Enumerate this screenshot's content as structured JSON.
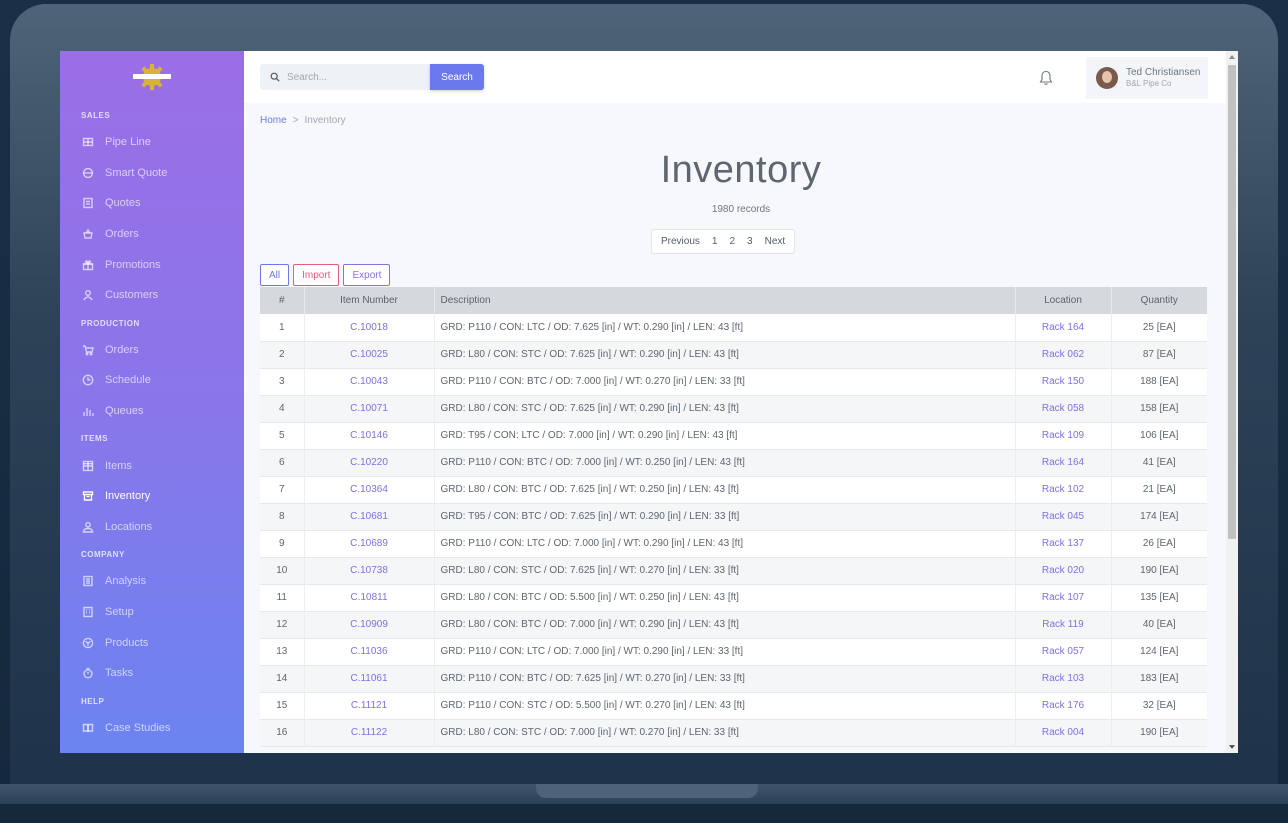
{
  "sidebar": {
    "sections": [
      {
        "head": "SALES",
        "items": [
          {
            "label": "Pipe Line",
            "icon": "pipeline-icon"
          },
          {
            "label": "Smart Quote",
            "icon": "smart-quote-icon"
          },
          {
            "label": "Quotes",
            "icon": "quotes-icon"
          },
          {
            "label": "Orders",
            "icon": "basket-icon"
          },
          {
            "label": "Promotions",
            "icon": "gift-icon"
          },
          {
            "label": "Customers",
            "icon": "user-icon"
          }
        ]
      },
      {
        "head": "PRODUCTION",
        "items": [
          {
            "label": "Orders",
            "icon": "cart-icon"
          },
          {
            "label": "Schedule",
            "icon": "clock-icon"
          },
          {
            "label": "Queues",
            "icon": "bar-chart-icon"
          }
        ]
      },
      {
        "head": "ITEMS",
        "items": [
          {
            "label": "Items",
            "icon": "grid-icon"
          },
          {
            "label": "Inventory",
            "icon": "inventory-icon",
            "active": true
          },
          {
            "label": "Locations",
            "icon": "location-icon"
          }
        ]
      },
      {
        "head": "COMPANY",
        "items": [
          {
            "label": "Analysis",
            "icon": "document-icon"
          },
          {
            "label": "Setup",
            "icon": "building-icon"
          },
          {
            "label": "Products",
            "icon": "cube-icon"
          },
          {
            "label": "Tasks",
            "icon": "timer-icon"
          }
        ]
      },
      {
        "head": "HELP",
        "items": [
          {
            "label": "Case Studies",
            "icon": "book-icon"
          }
        ]
      }
    ]
  },
  "header": {
    "search_placeholder": "Search...",
    "search_button": "Search",
    "user_name": "Ted Christiansen",
    "user_company": "B&L Pipe Co"
  },
  "breadcrumb": {
    "home": "Home",
    "separator": ">",
    "current": "Inventory"
  },
  "page": {
    "title": "Inventory",
    "record_count": "1980 records",
    "pager": {
      "previous": "Previous",
      "pages": [
        "1",
        "2",
        "3"
      ],
      "next": "Next"
    },
    "filters": {
      "all": "All",
      "import": "Import",
      "export": "Export"
    }
  },
  "table": {
    "columns": [
      "#",
      "Item Number",
      "Description",
      "Location",
      "Quantity"
    ],
    "rows": [
      [
        "1",
        "C.10018",
        "GRD: P110 / CON: LTC / OD: 7.625 [in] / WT: 0.290 [in] / LEN: 43 [ft]",
        "Rack 164",
        "25 [EA]"
      ],
      [
        "2",
        "C.10025",
        "GRD: L80 / CON: STC / OD: 7.625 [in] / WT: 0.290 [in] / LEN: 43 [ft]",
        "Rack 062",
        "87 [EA]"
      ],
      [
        "3",
        "C.10043",
        "GRD: P110 / CON: BTC / OD: 7.000 [in] / WT: 0.270 [in] / LEN: 33 [ft]",
        "Rack 150",
        "188 [EA]"
      ],
      [
        "4",
        "C.10071",
        "GRD: L80 / CON: STC / OD: 7.625 [in] / WT: 0.290 [in] / LEN: 43 [ft]",
        "Rack 058",
        "158 [EA]"
      ],
      [
        "5",
        "C.10146",
        "GRD: T95 / CON: LTC / OD: 7.000 [in] / WT: 0.290 [in] / LEN: 43 [ft]",
        "Rack 109",
        "106 [EA]"
      ],
      [
        "6",
        "C.10220",
        "GRD: P110 / CON: BTC / OD: 7.000 [in] / WT: 0.250 [in] / LEN: 43 [ft]",
        "Rack 164",
        "41 [EA]"
      ],
      [
        "7",
        "C.10364",
        "GRD: L80 / CON: BTC / OD: 7.625 [in] / WT: 0.250 [in] / LEN: 43 [ft]",
        "Rack 102",
        "21 [EA]"
      ],
      [
        "8",
        "C.10681",
        "GRD: T95 / CON: BTC / OD: 7.625 [in] / WT: 0.290 [in] / LEN: 33 [ft]",
        "Rack 045",
        "174 [EA]"
      ],
      [
        "9",
        "C.10689",
        "GRD: P110 / CON: LTC / OD: 7.000 [in] / WT: 0.290 [in] / LEN: 43 [ft]",
        "Rack 137",
        "26 [EA]"
      ],
      [
        "10",
        "C.10738",
        "GRD: L80 / CON: STC / OD: 7.625 [in] / WT: 0.270 [in] / LEN: 33 [ft]",
        "Rack 020",
        "190 [EA]"
      ],
      [
        "11",
        "C.10811",
        "GRD: L80 / CON: BTC / OD: 5.500 [in] / WT: 0.250 [in] / LEN: 43 [ft]",
        "Rack 107",
        "135 [EA]"
      ],
      [
        "12",
        "C.10909",
        "GRD: L80 / CON: BTC / OD: 7.000 [in] / WT: 0.290 [in] / LEN: 43 [ft]",
        "Rack 119",
        "40 [EA]"
      ],
      [
        "13",
        "C.11036",
        "GRD: P110 / CON: LTC / OD: 7.000 [in] / WT: 0.290 [in] / LEN: 33 [ft]",
        "Rack 057",
        "124 [EA]"
      ],
      [
        "14",
        "C.11061",
        "GRD: P110 / CON: BTC / OD: 7.625 [in] / WT: 0.270 [in] / LEN: 33 [ft]",
        "Rack 103",
        "183 [EA]"
      ],
      [
        "15",
        "C.11121",
        "GRD: P110 / CON: STC / OD: 5.500 [in] / WT: 0.270 [in] / LEN: 43 [ft]",
        "Rack 176",
        "32 [EA]"
      ],
      [
        "16",
        "C.11122",
        "GRD: L80 / CON: STC / OD: 7.000 [in] / WT: 0.270 [in] / LEN: 33 [ft]",
        "Rack 004",
        "190 [EA]"
      ]
    ]
  },
  "colors": {
    "accent": "#6c79ee",
    "link": "#7b72e6",
    "import": "#e35d7d",
    "sidebar_top": "#9b6ee6",
    "sidebar_bottom": "#6b84f0"
  }
}
